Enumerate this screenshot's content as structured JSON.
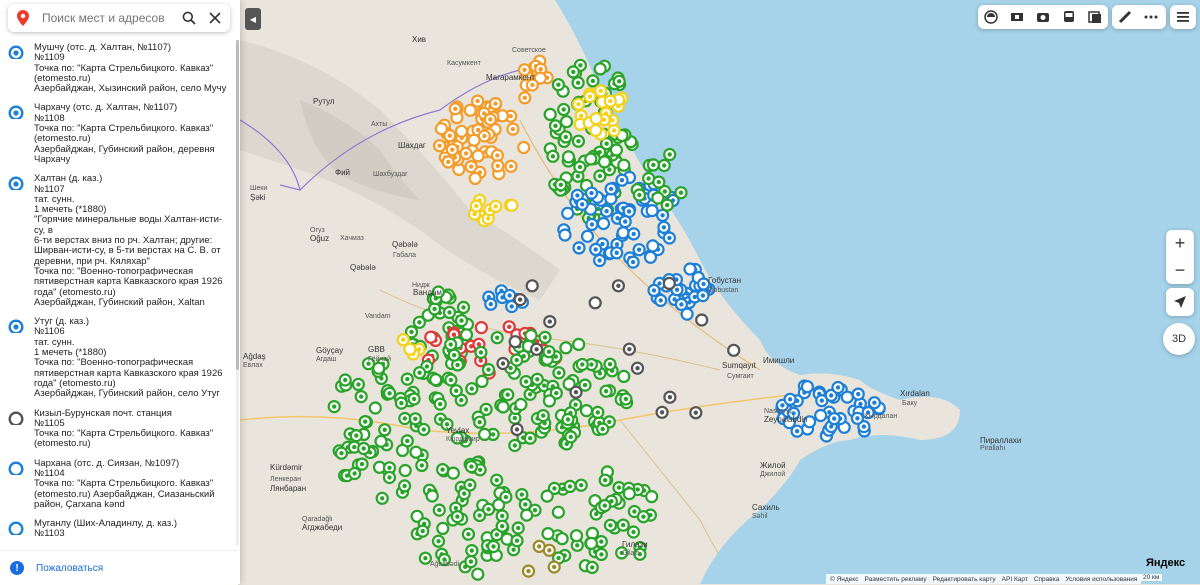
{
  "search": {
    "placeholder": "Поиск мест и адресов"
  },
  "colors": {
    "orange": "#f39c2c",
    "green": "#2aa32a",
    "blue": "#1e7fd6",
    "red": "#e03a3a",
    "yellow": "#f3d21e",
    "dark": "#555555",
    "olive": "#9a8a2a",
    "sea": "#a6d3ea",
    "land": "#e9e5dc",
    "panel_active": "#1a6de0"
  },
  "list": [
    {
      "marker": "blue",
      "lines": [
        "Мушчу (отс. д. Халтан, №1107)",
        "№1109",
        "Точка по: \"Карта Стрельбицкого. Кавказ\"",
        "(etomesto.ru)",
        "Азербайджан, Хызинский район, село Мучу"
      ]
    },
    {
      "marker": "blue",
      "lines": [
        "Чархачу (отс. д. Халтан, №1107)",
        "№1108",
        "Точка по: \"Карта Стрельбицкого. Кавказ\"",
        "(etomesto.ru)",
        "Азербайджан, Губинский район, деревня",
        "Чархачу"
      ]
    },
    {
      "marker": "blue",
      "lines": [
        "Халтан (д. каз.)",
        "№1107",
        "тат. сунн.",
        "1 мечеть (*1880)",
        "\"Горячие минеральные воды Халтан-исти-су, в",
        "6-ти верстах вниз по рч. Халтан; другие:",
        "Ширван-исти-су, в 5-ти верстах на С. В. от",
        "деревни, при рч. Кяляхар\"",
        "Точка по: \"Военно-топографическая",
        "пятиверстная карта Кавказского края 1926",
        "года\" (etomesto.ru)",
        "Азербайджан, Губинский район, Xaltan"
      ]
    },
    {
      "marker": "blue",
      "lines": [
        "Утуг (д. каз.)",
        "№1106",
        "тат. сунн.",
        "1 мечеть (*1880)",
        "Точка по: \"Военно-топографическая",
        "пятиверстная карта Кавказского края 1926",
        "года\" (etomesto.ru)",
        "Азербайджан, Губинский район, село Утуг"
      ]
    },
    {
      "marker": "dark",
      "lines": [
        "Кизыл-Бурунская почт. станция",
        "№1105",
        "Точка по: \"Карта Стрельбицкого. Кавказ\"",
        "(etomesto.ru)"
      ]
    },
    {
      "marker": "blue-ring",
      "lines": [
        "Чархана (отс. д. Сиязан, №1097)",
        "№1104",
        "Точка по: \"Карта Стрельбицкого. Кавказ\"",
        "(etomesto.ru) Азербайджан, Сиазаньский",
        "район, Çarxana kənd"
      ]
    },
    {
      "marker": "blue-ring",
      "lines": [
        "Муганлу (Ших-Аладинлу, д. каз.)",
        "№1103"
      ]
    }
  ],
  "report": {
    "label": "Пожаловаться",
    "icon": "exclamation-icon"
  },
  "map_labels": [
    "Хив",
    "Касумкент",
    "Магарамкент",
    "Советское",
    "Рутул",
    "Ахты",
    "Шахдаг",
    "Шахбуздаг",
    "Фий",
    "Шеки",
    "Şəki",
    "Огуз",
    "Oğuz",
    "Хачмаз",
    "Qəbələ",
    "Габала",
    "Qəbələ",
    "Нидж",
    "Вандам",
    "Vandam",
    "GBB",
    "Гёйчай",
    "Göyçay",
    "Агдаш",
    "Ağdaş",
    "Евлах",
    "Yevlax",
    "Кюрдамир",
    "Kürdəmir",
    "Ленкеран",
    "Лянбаран",
    "Qaradağlı",
    "Агджабеди",
    "Ağcabədi",
    "Имишли",
    "Сумгаит",
    "Sumqayıt",
    "Nasosnu",
    "Zeynalabdin",
    "Хырдалан",
    "Xırdalan",
    "Баку",
    "Пираллахи",
    "Pirallahı",
    "Жилой",
    "Джилой",
    "Сахиль",
    "Səhil",
    "Гобустан",
    "Qobustan",
    "Гиләзи",
    "Gilazi",
    "Ширван",
    "Şirvan"
  ],
  "toolbar": {
    "icons": [
      "layers-icon",
      "panorama-icon",
      "photo-icon",
      "transport-icon",
      "traffic-icon",
      "ruler-icon",
      "more-icon",
      "menu-icon"
    ]
  },
  "zoom": {
    "plus": "+",
    "minus": "−"
  },
  "locate": {
    "icon": "locate-icon"
  },
  "view3d": {
    "label": "3D"
  },
  "footer": {
    "items": [
      "© Яндекс",
      "Разместить рекламу",
      "Редактировать карту",
      "API Карт",
      "Справка",
      "Условия использования"
    ],
    "scale": "20 км"
  },
  "brand": {
    "label": "Яндекс"
  }
}
